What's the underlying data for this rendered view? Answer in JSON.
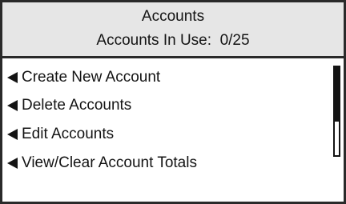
{
  "header": {
    "title": "Accounts",
    "status": "Accounts In Use:  0/25"
  },
  "menu": {
    "items": [
      {
        "label": "Create New Account"
      },
      {
        "label": "Delete Accounts"
      },
      {
        "label": "Edit Accounts"
      },
      {
        "label": "View/Clear Account Totals"
      }
    ]
  },
  "scrollbar": {
    "thumb_fraction": 0.62
  }
}
